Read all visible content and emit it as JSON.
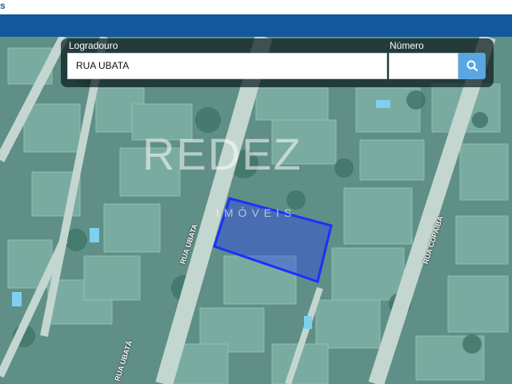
{
  "header": {
    "logo_fragment": "s"
  },
  "search": {
    "logradouro_label": "Logradouro",
    "logradouro_value": "RUA UBATA",
    "numero_label": "Número",
    "numero_value": "",
    "search_icon": "search-icon"
  },
  "map": {
    "watermark": {
      "brand": "REDEZ",
      "subtitle": "IMÓVEIS"
    },
    "streets": {
      "rua_ubata_upper": "RUA UBATA",
      "rua_ubata_lower": "RUA UBATÃ",
      "rua_copaiba": "RUA COPAÍBA"
    },
    "highlight_color": "#1f2fff"
  }
}
